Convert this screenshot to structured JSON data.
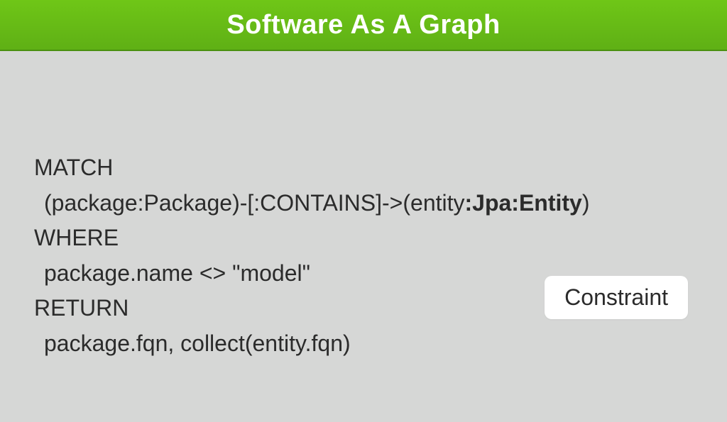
{
  "header": {
    "title": "Software As A Graph"
  },
  "code": {
    "kw_match": "MATCH",
    "line_match": "(package:Package)-[:CONTAINS]->(entity",
    "line_match_bold": ":Jpa:Entity",
    "line_match_close": ")",
    "kw_where": "WHERE",
    "line_where": "package.name <> \"model\"",
    "kw_return": "RETURN",
    "line_return": "package.fqn, collect(entity.fqn)"
  },
  "badge": {
    "label": "Constraint"
  }
}
